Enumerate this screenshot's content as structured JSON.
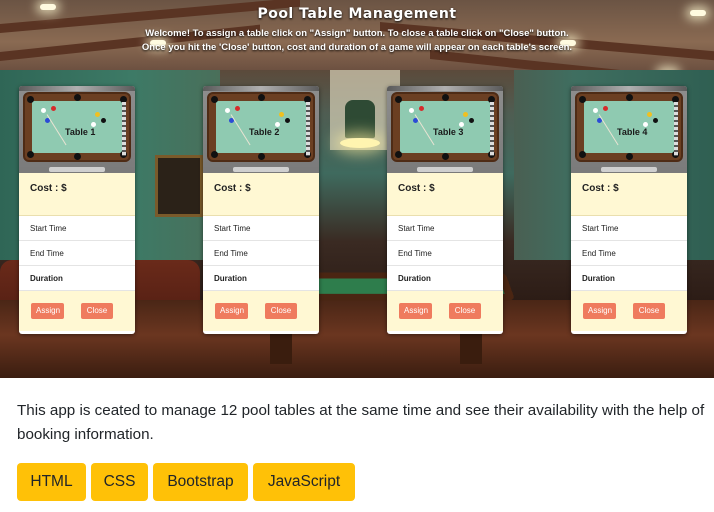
{
  "header": {
    "title": "Pool Table Management",
    "instruction_line1": "Welcome! To assign a table click on \"Assign\" button. To close a table click on \"Close\" button.",
    "instruction_line2": "Once you hit the 'Close' button, cost and duration of a game will appear on each table's screen."
  },
  "tables": [
    {
      "label": "Table 1",
      "cost": "Cost : $",
      "start_time": "Start Time",
      "end_time": "End Time",
      "duration": "Duration",
      "assign_label": "Assign",
      "close_label": "Close"
    },
    {
      "label": "Table 2",
      "cost": "Cost : $",
      "start_time": "Start Time",
      "end_time": "End Time",
      "duration": "Duration",
      "assign_label": "Assign",
      "close_label": "Close"
    },
    {
      "label": "Table 3",
      "cost": "Cost : $",
      "start_time": "Start Time",
      "end_time": "End Time",
      "duration": "Duration",
      "assign_label": "Assign",
      "close_label": "Close"
    },
    {
      "label": "Table 4",
      "cost": "Cost : $",
      "start_time": "Start Time",
      "end_time": "End Time",
      "duration": "Duration",
      "assign_label": "Assign",
      "close_label": "Close"
    }
  ],
  "description": "This app is ceated to manage 12 pool tables at the same time and see their availability with the help of booking information.",
  "tech_tags": [
    "HTML",
    "CSS",
    "Bootstrap",
    "JavaScript"
  ],
  "colors": {
    "tag_background": "#ffc107",
    "button_background": "#ef7b5e",
    "card_panel": "#fff8d3",
    "felt": "#8fcab1"
  }
}
